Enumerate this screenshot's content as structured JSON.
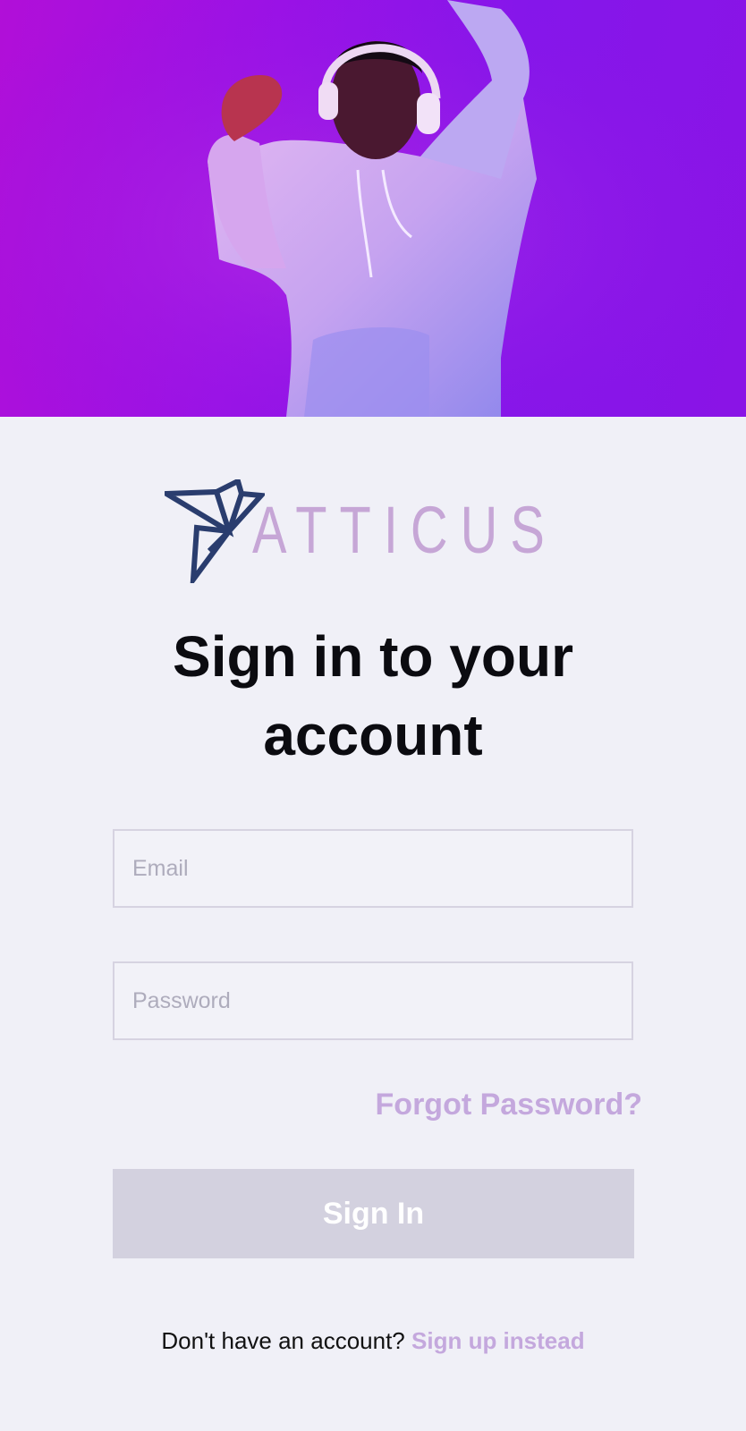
{
  "hero": {
    "image": "dancing-man-with-headphones",
    "background": "#9a12e6"
  },
  "brand": {
    "name": "ATTICUS",
    "mark_color": "#2a3d6e",
    "text_color": "#c6a6d6"
  },
  "heading": {
    "line1": "Sign in to your",
    "line2": "account"
  },
  "form": {
    "email_placeholder": "Email",
    "password_placeholder": "Password",
    "forgot_label": "Forgot Password?",
    "submit_label": "Sign In"
  },
  "footer": {
    "prompt": "Don't have an account?",
    "signup_label": "Sign up instead"
  },
  "colors": {
    "accent": "#c4a8dd",
    "button_disabled": "#d3d1df",
    "background": "#f0f0f7"
  }
}
